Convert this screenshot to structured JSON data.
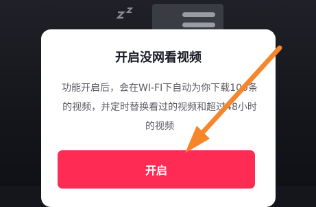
{
  "dialog": {
    "title": "开启没网看视频",
    "description": "功能开启后，会在WI-FI下自动为你下载100条的视频，并定时替换看过的视频和超过48小时的视频",
    "confirm_label": "开启"
  },
  "colors": {
    "backdrop": "#15161b",
    "dialog_bg": "#ffffff",
    "confirm_button": "#fe2c55",
    "annotation_arrow": "#f5862c"
  },
  "icons": [
    "sleep-z-icon",
    "menu-lines-icon",
    "annotation-arrow"
  ]
}
